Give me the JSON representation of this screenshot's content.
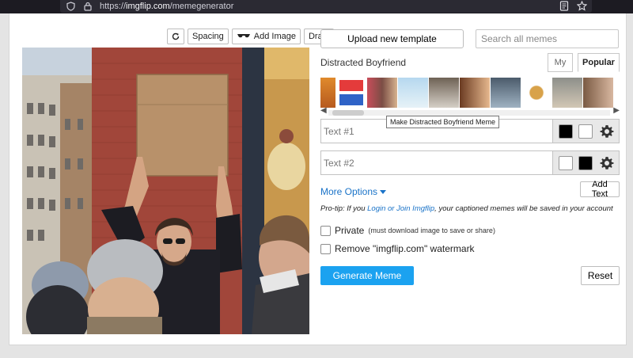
{
  "browser": {
    "url_scheme": "https://",
    "url_host": "imgflip.com",
    "url_path": "/memegenerator",
    "icons": [
      "shield-icon",
      "lock-icon",
      "reader-view-icon",
      "bookmark-star-icon"
    ]
  },
  "editor": {
    "toolbar": {
      "rotate_icon": "refresh-icon",
      "spacing_label": "Spacing",
      "add_image_label": "Add Image",
      "draw_label": "Draw"
    }
  },
  "form": {
    "upload_label": "Upload new template",
    "search_placeholder": "Search all memes",
    "template_name": "Distracted Boyfriend",
    "tabs": {
      "my": "My",
      "popular": "Popular"
    },
    "tooltip": "Make Distracted Boyfriend Meme",
    "text_boxes": [
      {
        "placeholder": "Text #1",
        "fill": "#000000",
        "outline": "#ffffff"
      },
      {
        "placeholder": "Text #2",
        "fill": "#ffffff",
        "outline": "#000000"
      }
    ],
    "more_options_label": "More Options",
    "add_text_label": "Add Text",
    "protip": {
      "prefix": "Pro-tip: If you ",
      "link": "Login or Join Imgflip",
      "suffix": ", your captioned memes will be saved in your account"
    },
    "private_label": "Private",
    "private_note": "(must download image to save or share)",
    "watermark_label": "Remove \"imgflip.com\" watermark",
    "generate_label": "Generate Meme",
    "reset_label": "Reset"
  },
  "colors": {
    "accent": "#1ba2f0",
    "link": "#1a73c8"
  }
}
